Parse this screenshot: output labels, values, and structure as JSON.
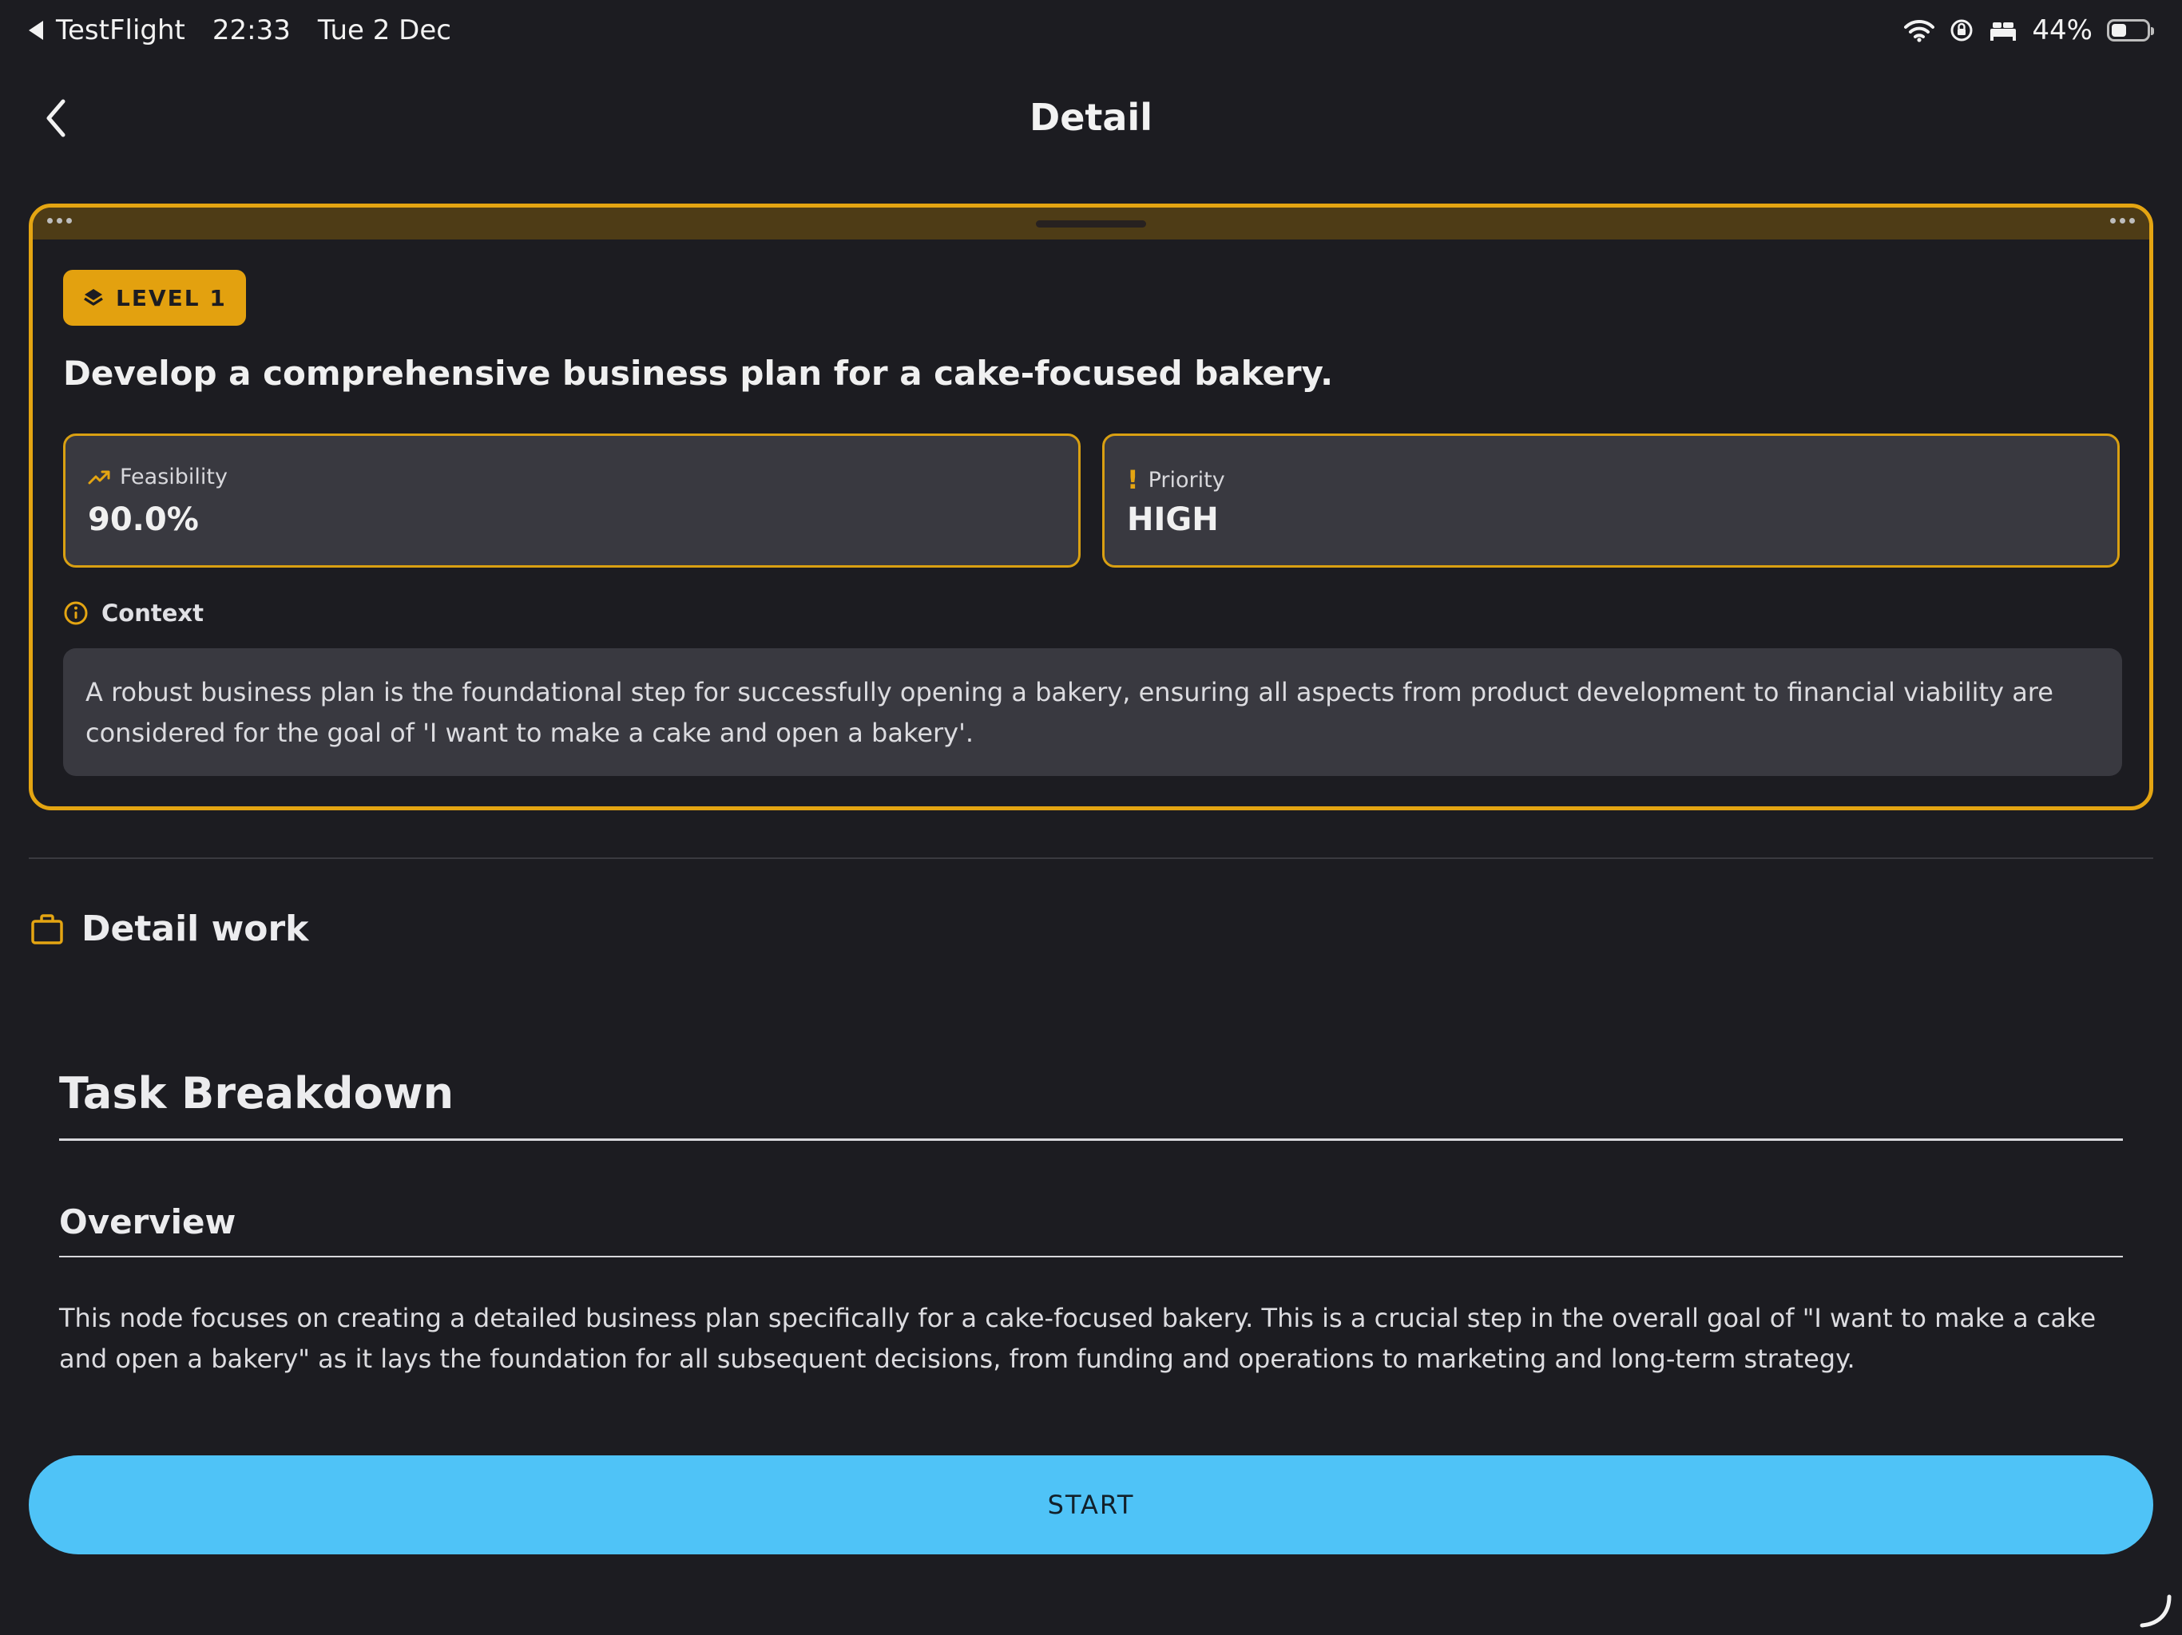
{
  "status_bar": {
    "back_app": "TestFlight",
    "time": "22:33",
    "date": "Tue 2 Dec",
    "battery": "44%",
    "battery_level": 0.44
  },
  "nav": {
    "title": "Detail"
  },
  "card": {
    "level_badge": "LEVEL 1",
    "title": "Develop a comprehensive business plan for a cake-focused bakery.",
    "feasibility": {
      "label": "Feasibility",
      "value": "90.0%"
    },
    "priority": {
      "label": "Priority",
      "icon_glyph": "!",
      "value": "HIGH"
    },
    "context": {
      "label": "Context",
      "text": "A robust business plan is the foundational step for successfully opening a bakery, ensuring all aspects from product development to financial viability are considered for the goal of 'I want to make a cake and open a bakery'."
    }
  },
  "detail_work": {
    "heading": "Detail work",
    "task_heading": "Task Breakdown",
    "overview_heading": "Overview",
    "overview_text": "This node focuses on creating a detailed business plan specifically for a cake-focused bakery. This is a crucial step in the overall goal of \"I want to make a cake and open a bakery\" as it lays the foundation for all subsequent decisions, from funding and operations to marketing and long-term strategy."
  },
  "start_button": {
    "label": "START"
  },
  "colors": {
    "accent": "#e4a512",
    "button": "#4fc3f7",
    "background": "#1c1c21",
    "panel": "#393940"
  },
  "icons": {
    "status_back": "back-triangle-icon",
    "wifi": "wifi-icon",
    "orientation_lock": "orientation-lock-icon",
    "sleep": "bed-icon",
    "battery": "battery-icon",
    "nav_back": "chevron-left-icon",
    "level": "layers-icon",
    "feasibility": "trending-up-icon",
    "priority": "exclamation-icon",
    "context": "info-icon",
    "detail_work": "briefcase-icon"
  }
}
